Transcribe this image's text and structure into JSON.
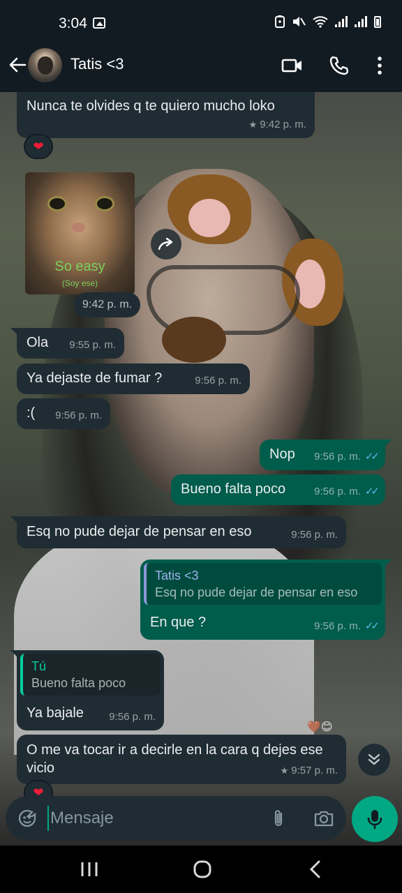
{
  "status_bar": {
    "time": "3:04"
  },
  "header": {
    "contact_name": "Tatis <3"
  },
  "messages": [
    {
      "text": "Nunca te olvides q te quiero mucho loko",
      "time": "9:42 p. m.",
      "reaction": "heart"
    },
    {
      "sticker_caption": "So easy",
      "sticker_subcaption": "(Soy ese)",
      "time": "9:42 p. m."
    },
    {
      "text": "Ola",
      "time": "9:55 p. m."
    },
    {
      "text": "Ya dejaste de fumar ?",
      "time": "9:56 p. m."
    },
    {
      "text": ":(",
      "time": "9:56 p. m."
    },
    {
      "text": "Nop",
      "time": "9:56 p. m.",
      "status": "read"
    },
    {
      "text": "Bueno falta poco",
      "time": "9:56 p. m.",
      "status": "read"
    },
    {
      "text": "Esq no pude dejar de pensar en eso",
      "time": "9:56 p. m."
    },
    {
      "quote_name": "Tatis <3",
      "quote_text": "Esq no pude dejar de pensar en eso",
      "text": "En que ?",
      "time": "9:56 p. m.",
      "status": "read"
    },
    {
      "quote_name": "Tú",
      "quote_text": "Bueno falta poco",
      "text": "Ya bajale",
      "time": "9:56 p. m."
    },
    {
      "text": "O me va tocar ir a decirle en la cara q dejes ese vicio",
      "time": "9:57 p. m.",
      "reaction": "heart"
    }
  ],
  "composer": {
    "placeholder": "Mensaje"
  },
  "colors": {
    "incoming": "#202c33",
    "outgoing": "#005c4b",
    "accent": "#00a884",
    "read_ticks": "#53bdeb"
  }
}
